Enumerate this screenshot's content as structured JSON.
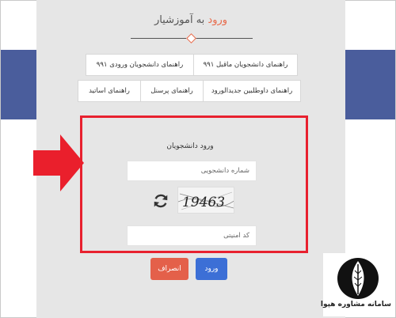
{
  "header": {
    "title_highlight": "ورود",
    "title_rest": "به آموزشیار"
  },
  "links": {
    "row1": [
      {
        "label": "راهنمای دانشجویان ماقبل ۹۹۱"
      },
      {
        "label": "راهنمای دانشجویان ورودی ۹۹۱"
      }
    ],
    "row2": [
      {
        "label": "راهنمای داوطلبین جدیدالورود"
      },
      {
        "label": "راهنمای پرسنل"
      },
      {
        "label": "راهنمای اساتید"
      }
    ]
  },
  "form": {
    "title": "ورود دانشجویان",
    "student_number_placeholder": "شماره دانشجویی",
    "security_code_placeholder": "کد امنیتی",
    "captcha_text": "19463"
  },
  "buttons": {
    "login": "ورود",
    "cancel": "انصراف"
  },
  "branding": {
    "name": "سامانه مشاوره هپوا"
  },
  "colors": {
    "band": "#4a5d9c",
    "panel": "#e6e6e6",
    "highlight": "#e8212f",
    "login": "#3c6fd6",
    "cancel": "#e4604a"
  }
}
